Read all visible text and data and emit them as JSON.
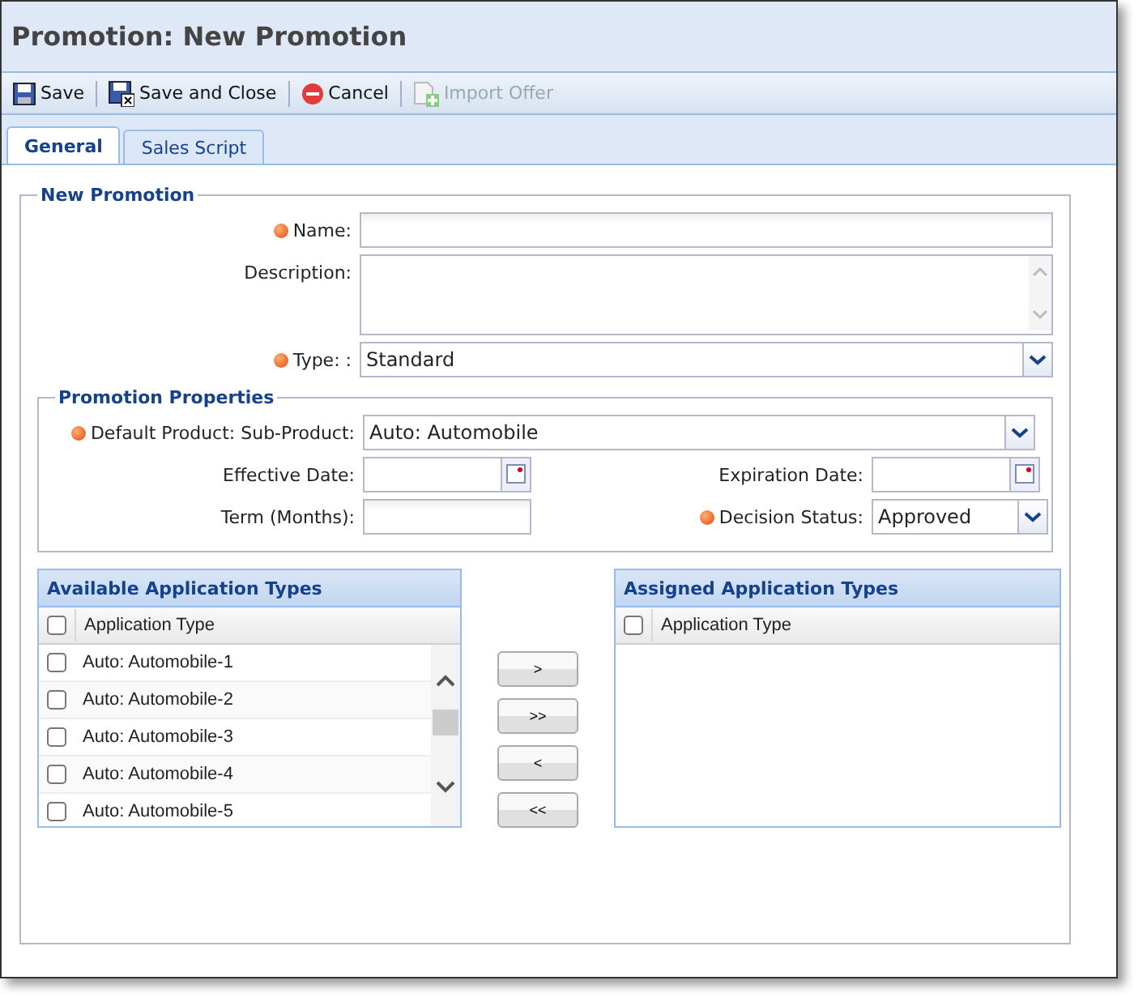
{
  "window": {
    "title": "Promotion: New Promotion"
  },
  "toolbar": [
    {
      "label": "Save",
      "kind": "save",
      "disabled": false
    },
    {
      "label": "Save and Close",
      "kind": "saveclose",
      "disabled": false
    },
    {
      "label": "Cancel",
      "kind": "cancel",
      "disabled": false
    },
    {
      "label": "Import Offer",
      "kind": "import",
      "disabled": true
    }
  ],
  "tabs": [
    {
      "label": "General",
      "selected": true
    },
    {
      "label": "Sales Script",
      "selected": false
    }
  ],
  "form": {
    "legend": "New Promotion",
    "fields": [
      {
        "label": "Name:",
        "kind": "text",
        "required": true
      },
      {
        "label": "Description:",
        "kind": "textarea",
        "required": false
      },
      {
        "label": "Type: :",
        "kind": "select",
        "required": true,
        "value": "Standard"
      }
    ],
    "properties": {
      "legend": "Promotion Properties",
      "product": {
        "label": "Default Product: Sub-Product:",
        "required": true,
        "value": "Auto: Automobile"
      },
      "effective_date": {
        "label": "Effective Date:",
        "required": false
      },
      "expiration_date": {
        "label": "Expiration Date:",
        "required": false
      },
      "term": {
        "label": "Term (Months):",
        "required": false
      },
      "decision_status": {
        "label": "Decision Status:",
        "required": true,
        "value": "Approved"
      }
    }
  },
  "available": {
    "title": "Available Application Types",
    "column": "Application Type",
    "header_checked": false,
    "rows": [
      {
        "label": "Auto: Automobile-1",
        "checked": false
      },
      {
        "label": "Auto: Automobile-2",
        "checked": false
      },
      {
        "label": "Auto: Automobile-3",
        "checked": false
      },
      {
        "label": "Auto: Automobile-4",
        "checked": false
      },
      {
        "label": "Auto: Automobile-5",
        "checked": false
      }
    ]
  },
  "move_buttons": [
    ">",
    ">>",
    "<",
    "<<"
  ],
  "assigned": {
    "title": "Assigned Application Types",
    "column": "Application Type",
    "header_checked": false
  }
}
